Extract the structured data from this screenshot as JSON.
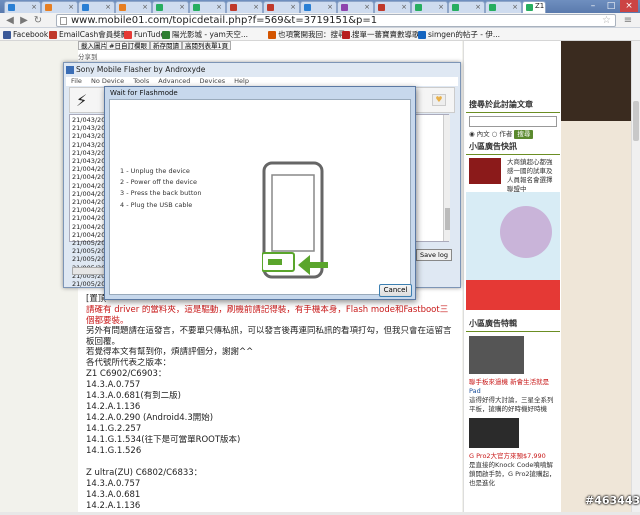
{
  "browser": {
    "url": "www.mobile01.com/topicdetail.php?f=569&t=3719151&p=1",
    "active_tab_label": "Z1",
    "bookmarks": [
      {
        "label": "Facebook",
        "color": "#3b5998"
      },
      {
        "label": "EmailCash會員獎勵",
        "color": "#c0392b"
      },
      {
        "label": "FunTude",
        "color": "#e53935"
      },
      {
        "label": "陽光影城 - yam天空...",
        "color": "#2e7d32"
      },
      {
        "label": "也項驚開我回：搜尋...",
        "color": "#d35400"
      },
      {
        "label": "搜單一蕃寶賣數導歌...",
        "color": "#b71c1c"
      },
      {
        "label": "simgen的帖子 - 伊...",
        "color": "#1565c0"
      }
    ]
  },
  "article_top": {
    "buttons": [
      "載入圖片",
      "#日自訂欄眼",
      "新存閱讀",
      "高閱列表單1頁"
    ],
    "share_label": "分享到"
  },
  "article": {
    "lines": [
      {
        "text": "[置頂",
        "style": "plain"
      },
      {
        "text": "請確有 driver 的當料夾，這是驅動，刷機前請記得裝，有手機本身，Flash mode和Fastboot三個都要裝。",
        "style": "red"
      },
      {
        "text": "另外有問題請在這發言，不要單只傳私訊，可以發言後再連同私訊的看項打勾，但我只會在這留言板回覆。",
        "style": "wrap"
      },
      {
        "text": "若覺得本文有幫到你，煩請評個分，謝謝^^",
        "style": "plain"
      },
      {
        "text": "各代號所代表之版本：",
        "style": "plain"
      },
      {
        "text": "Z1 C6902/C6903：",
        "style": "plain"
      },
      {
        "text": "14.3.A.0.757",
        "style": "plain"
      },
      {
        "text": "14.3.A.0.681(有到二版)",
        "style": "plain"
      },
      {
        "text": "14.2.A.1.136",
        "style": "plain"
      },
      {
        "text": "14.2.A.0.290 (Android4.3開始)",
        "style": "plain"
      },
      {
        "text": "14.1.G.2.257",
        "style": "plain"
      },
      {
        "text": "14.1.G.1.534(往下是可當單ROOT版本)",
        "style": "plain"
      },
      {
        "text": "14.1.G.1.526",
        "style": "plain"
      },
      {
        "text": "",
        "style": "plain"
      },
      {
        "text": "Z ultra(ZU) C6802/C6833：",
        "style": "plain"
      },
      {
        "text": "14.3.A.0.757",
        "style": "plain"
      },
      {
        "text": "14.3.A.0.681",
        "style": "plain"
      },
      {
        "text": "14.2.A.1.136",
        "style": "plain"
      }
    ]
  },
  "sidebar": {
    "search_heading": "搜尋於此討論文章",
    "radio_content": "內文",
    "radio_author": "作者",
    "search_button": "搜尋",
    "ad_heading": "小區廣告快訊",
    "ad_text": "大商鎮超心都強感一國的試車及人員報名會選擇聯盟中",
    "ad2_heading": "小區廣告特輯",
    "promo_lines": [
      "聯手板來過機 新會生活就是",
      "Pad",
      "這得好得大討論，三星全系列平板，搶購的好時機好時機"
    ],
    "promo2_lines": [
      "G Pro2大官方來預$7,990",
      "是直接的Knock Code噴噴解鎖開啟手勢，G Pro2搶購起，也是進化"
    ]
  },
  "sony_window": {
    "title": "Sony Mobile Flasher by Androxyde",
    "menu": [
      "File",
      "No Device",
      "Tools",
      "Advanced",
      "Devices",
      "Help"
    ],
    "log_lines": [
      "21/043/20",
      "21/043/20",
      "21/043/20",
      "21/043/20",
      "21/043/20",
      "21/043/20",
      "21/004/20",
      "21/004/20",
      "21/004/20",
      "21/004/20",
      "21/004/20",
      "21/004/20",
      "21/004/20",
      "21/004/20",
      "21/004/20",
      "21/005/20",
      "21/005/20",
      "21/005/20",
      "21/005/20",
      "21/005/20",
      "21/005/20"
    ],
    "save_log_label": "Save log"
  },
  "dialog": {
    "title": "Wait for Flashmode",
    "steps": [
      "1 - Unplug the device",
      "2 - Power off the device",
      "3 - Press the back button",
      "4 - Plug the USB cable"
    ],
    "cancel_label": "Cancel"
  },
  "watermark": "#463443"
}
